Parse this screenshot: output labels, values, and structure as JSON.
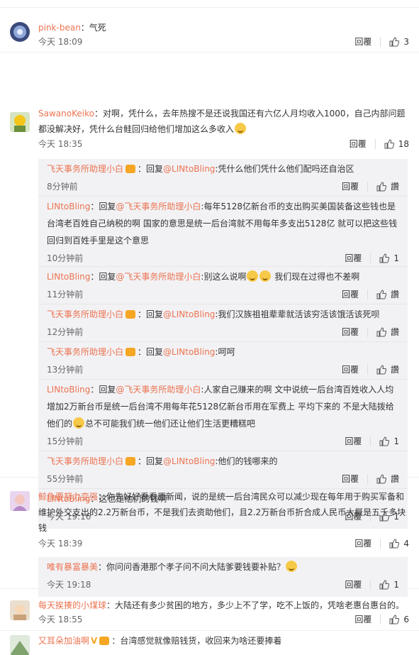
{
  "labels": {
    "reply": "回覆",
    "like_hidden": "讚",
    "reply_to": "回复"
  },
  "comments": [
    {
      "user": "pink-bean",
      "text": "：气死",
      "time": "今天 18:09",
      "likes": "3"
    },
    {
      "user": "SawanoKeiko",
      "text": "：对啊，凭什么，去年热搜不是还说我国还有六亿人月均收入1000，自己内部问题都没解决好，凭什么台鲑回归给他们增加这么多收入",
      "time": "今天 18:35",
      "likes": "18",
      "replies": [
        {
          "user": "飞天事务所助理小白",
          "reply_target": "@LINtoBling",
          "text": ":凭什么他们凭什么他们配吗还自治区",
          "time": "8分钟前",
          "likes": "讚"
        },
        {
          "user": "LINtoBling",
          "prefix": "：回复",
          "reply_target": "@飞天事务所助理小白",
          "text": ":每年5128亿新台币的支出购买美国装备这些钱也是台湾老百姓自己纳税的啊 国家的意思是统一后台湾就不用每年多支出5128亿 就可以把这些钱回归到百姓手里是这个意思",
          "time": "10分钟前",
          "likes": "1"
        },
        {
          "user": "LINtoBling",
          "reply_target": "@飞天事务所助理小白",
          "text": ":别这么说啊",
          "text2": " 我们现在过得也不差啊",
          "time": "11分钟前",
          "likes": "讚"
        },
        {
          "user": "飞天事务所助理小白",
          "reply_target": "@LINtoBling",
          "text": ":我们汉族祖祖辈辈就活该穷活该饿活该死呗",
          "time": "12分钟前",
          "likes": "讚"
        },
        {
          "user": "飞天事务所助理小白",
          "reply_target": "@LINtoBling",
          "text": ":呵呵",
          "time": "13分钟前",
          "likes": "讚"
        },
        {
          "user": "LINtoBling",
          "reply_target": "@飞天事务所助理小白",
          "text": ":人家自己赚来的啊 文中说统一后台湾百姓收入人均增加2万新台币是统一后台湾不用每年花5128亿新台币用在军费上 平均下来的 不是大陆拨给他们的",
          "text2": "总不可能我们统一他们还让他们生活更糟糕吧",
          "time": "15分钟前",
          "likes": "1"
        },
        {
          "user": "飞天事务所助理小白",
          "reply_target": "@LINtoBling",
          "text": ":他们的钱哪来的",
          "time": "55分钟前",
          "likes": "讚"
        },
        {
          "user": "LINtoBling",
          "text": "：这也是他们的钱啊",
          "time": "今天 19:16",
          "likes": "1"
        }
      ]
    },
    {
      "user": "鲸鱼要努力变强",
      "text": "：你先好好看看原新闻，说的是统一后台湾民众可以减少现在每年用于购买军备和维护外交支出的2.2万新台币，不是我们去资助他们，且2.2万新台币折合成人民币大概是五千多块钱",
      "time": "今天 18:39",
      "likes": "4",
      "replies": [
        {
          "user": "唯有暴富暴美",
          "text": "：你问问香港那个孝子问不问大陆爹要钱要补贴？",
          "time": "今天 19:18",
          "likes": "1"
        }
      ]
    },
    {
      "user": "每天挨揍的小煤球",
      "text": "：大陆还有多少贫困的地方，多少上不了学，吃不上饭的，凭啥老惠台惠台的。",
      "time": "今天 18:55",
      "likes": "6"
    },
    {
      "user": "又耳朵加油啊",
      "text": "：台湾感觉就像赔钱货，收回来为啥还要捧着",
      "time": "",
      "likes": ""
    }
  ],
  "colors": {
    "username": "#eb7350",
    "reply_bg": "#f2f2f5",
    "text": "#333333",
    "meta": "#666666"
  }
}
